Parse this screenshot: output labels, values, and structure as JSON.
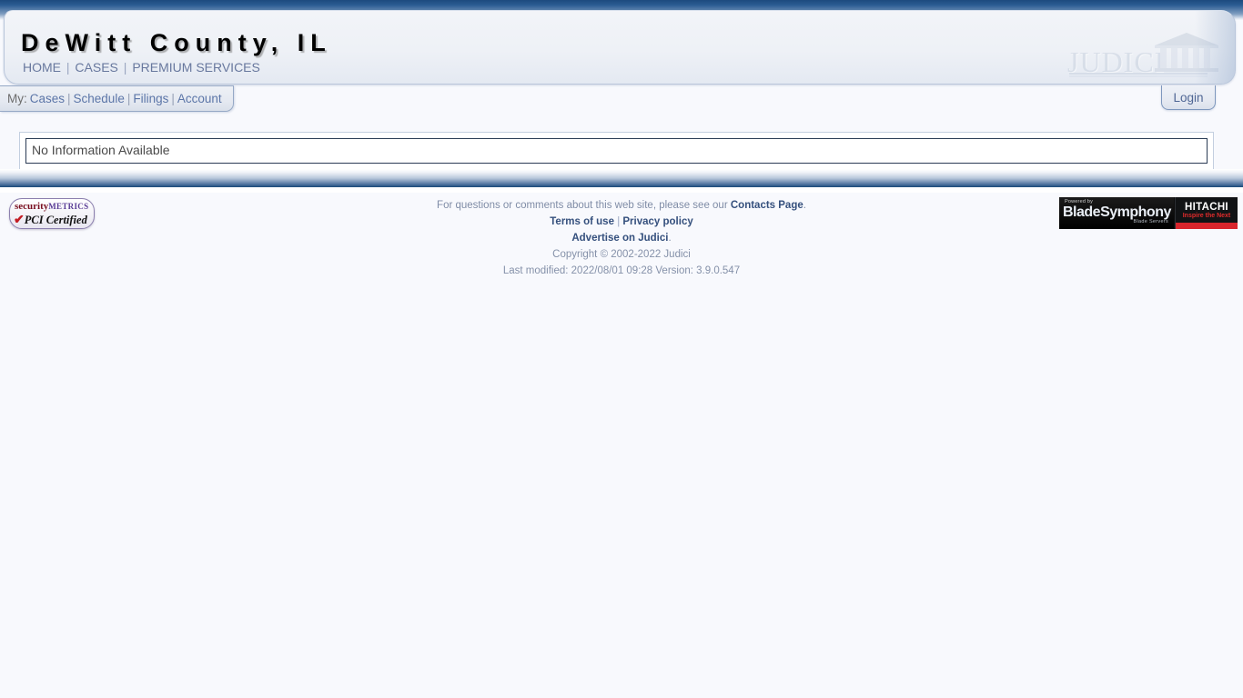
{
  "header": {
    "site_title": "DeWitt County, IL",
    "nav": [
      {
        "label": "HOME"
      },
      {
        "label": "CASES"
      },
      {
        "label": "PREMIUM SERVICES"
      }
    ],
    "separator": "|",
    "logo_text": "JUDICI",
    "logo_icon": "courthouse-icon"
  },
  "toolbar": {
    "my_label": "My:",
    "my_links": [
      {
        "label": "Cases"
      },
      {
        "label": "Schedule"
      },
      {
        "label": "Filings"
      },
      {
        "label": "Account"
      }
    ],
    "separator": "|",
    "login_label": "Login"
  },
  "main": {
    "message": "No Information Available"
  },
  "footer": {
    "contact_prefix": "For questions or comments about this web site, please see our ",
    "contact_link": "Contacts Page",
    "contact_suffix": ".",
    "terms_link": "Terms of use",
    "privacy_link": "Privacy policy",
    "separator": "|",
    "advertise_link": "Advertise on Judici",
    "advertise_suffix": ".",
    "copyright": "Copyright © 2002-2022 Judici",
    "last_modified": "Last modified: 2022/08/01 09:28 Version: 3.9.0.547"
  },
  "badges": {
    "security_metrics": {
      "word_security": "security",
      "word_metrics": "METRICS",
      "check": "✔",
      "certified": "PCI Certified"
    },
    "blade_symphony": {
      "powered_by": "Powered by",
      "name": "BladeSymphony",
      "sub": "Blade Servers",
      "vendor": "HITACHI",
      "tagline": "Inspire the Next"
    }
  },
  "colors": {
    "accent_blue": "#1f4e7f",
    "link_blue": "#5c76a8",
    "nav_blue": "#68789e",
    "footer_link": "#35507d",
    "page_bg": "#f8f9fd",
    "hitachi_red": "#d8252c"
  }
}
